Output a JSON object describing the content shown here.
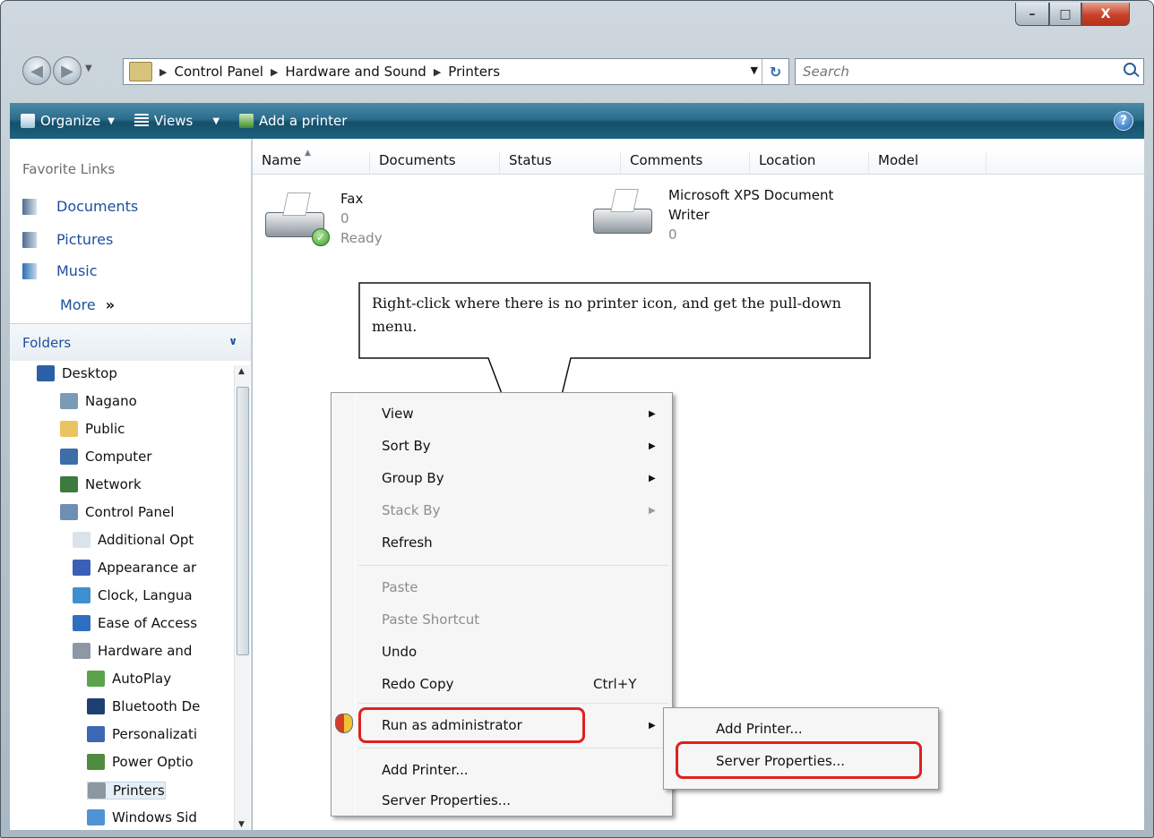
{
  "window": {
    "controls": {
      "minimize": "–",
      "maximize": "□",
      "close": "X"
    }
  },
  "address": {
    "crumbs": [
      "Control Panel",
      "Hardware and Sound",
      "Printers"
    ],
    "search_placeholder": "Search"
  },
  "toolbar": {
    "organize": "Organize",
    "views": "Views",
    "add_printer": "Add a printer",
    "help": "?"
  },
  "nav": {
    "favorites_title": "Favorite Links",
    "favorites": [
      "Documents",
      "Pictures",
      "Music"
    ],
    "more": "More",
    "more_glyph": "»",
    "folders_title": "Folders",
    "tree": [
      {
        "label": "Desktop",
        "level": 0,
        "icon": "desktop-icon",
        "color": "#2b5fa8"
      },
      {
        "label": "Nagano",
        "level": 1,
        "icon": "user-folder-icon",
        "color": "#7a9bb8"
      },
      {
        "label": "Public",
        "level": 1,
        "icon": "folder-icon",
        "color": "#e8c560"
      },
      {
        "label": "Computer",
        "level": 1,
        "icon": "computer-icon",
        "color": "#3d6ea8"
      },
      {
        "label": "Network",
        "level": 1,
        "icon": "network-icon",
        "color": "#3d7a3d"
      },
      {
        "label": "Control Panel",
        "level": 1,
        "icon": "control-panel-icon",
        "color": "#6f8fb2"
      },
      {
        "label": "Additional Opt",
        "level": 2,
        "icon": "checkbox-icon",
        "color": "#d9e3ec"
      },
      {
        "label": "Appearance ar",
        "level": 2,
        "icon": "appearance-icon",
        "color": "#3b5fb7"
      },
      {
        "label": "Clock, Langua",
        "level": 2,
        "icon": "globe-icon",
        "color": "#3e8fd0"
      },
      {
        "label": "Ease of Access",
        "level": 2,
        "icon": "ease-of-access-icon",
        "color": "#2f6fc2"
      },
      {
        "label": "Hardware and",
        "level": 2,
        "icon": "hardware-icon",
        "color": "#8c98a3"
      },
      {
        "label": "AutoPlay",
        "level": 3,
        "icon": "autoplay-icon",
        "color": "#5ba34b"
      },
      {
        "label": "Bluetooth De",
        "level": 3,
        "icon": "bluetooth-icon",
        "color": "#1f3f73"
      },
      {
        "label": "Personalizati",
        "level": 3,
        "icon": "personalization-icon",
        "color": "#3d67b5"
      },
      {
        "label": "Power Optio",
        "level": 3,
        "icon": "power-icon",
        "color": "#4f8c3f"
      },
      {
        "label": "Printers",
        "level": 3,
        "icon": "printer-icon",
        "color": "#8d97a0"
      },
      {
        "label": "Windows Sid",
        "level": 3,
        "icon": "sidebar-icon",
        "color": "#4f93d3"
      }
    ]
  },
  "columns": [
    "Name",
    "Documents",
    "Status",
    "Comments",
    "Location",
    "Model"
  ],
  "printers": [
    {
      "name": "Fax",
      "docs": "0",
      "status": "Ready"
    },
    {
      "name": "Microsoft XPS Document Writer",
      "name_line1": "Microsoft XPS Document",
      "name_line2": "Writer",
      "docs": "0"
    }
  ],
  "callout": "Right-click where there is no printer icon, and get the pull-down menu.",
  "context_menu": {
    "view": "View",
    "sort_by": "Sort By",
    "group_by": "Group By",
    "stack_by": "Stack By",
    "refresh": "Refresh",
    "paste": "Paste",
    "paste_shortcut": "Paste Shortcut",
    "undo": "Undo",
    "redo_copy": "Redo Copy",
    "redo_shortcut": "Ctrl+Y",
    "run_as_admin": "Run as administrator",
    "add_printer": "Add Printer...",
    "server_properties": "Server Properties..."
  },
  "submenu": {
    "add_printer": "Add Printer...",
    "server_properties": "Server Properties..."
  },
  "colors": {
    "link": "#1c4f9c",
    "highlight": "#e02020",
    "cmdbar": "#1d6180"
  }
}
